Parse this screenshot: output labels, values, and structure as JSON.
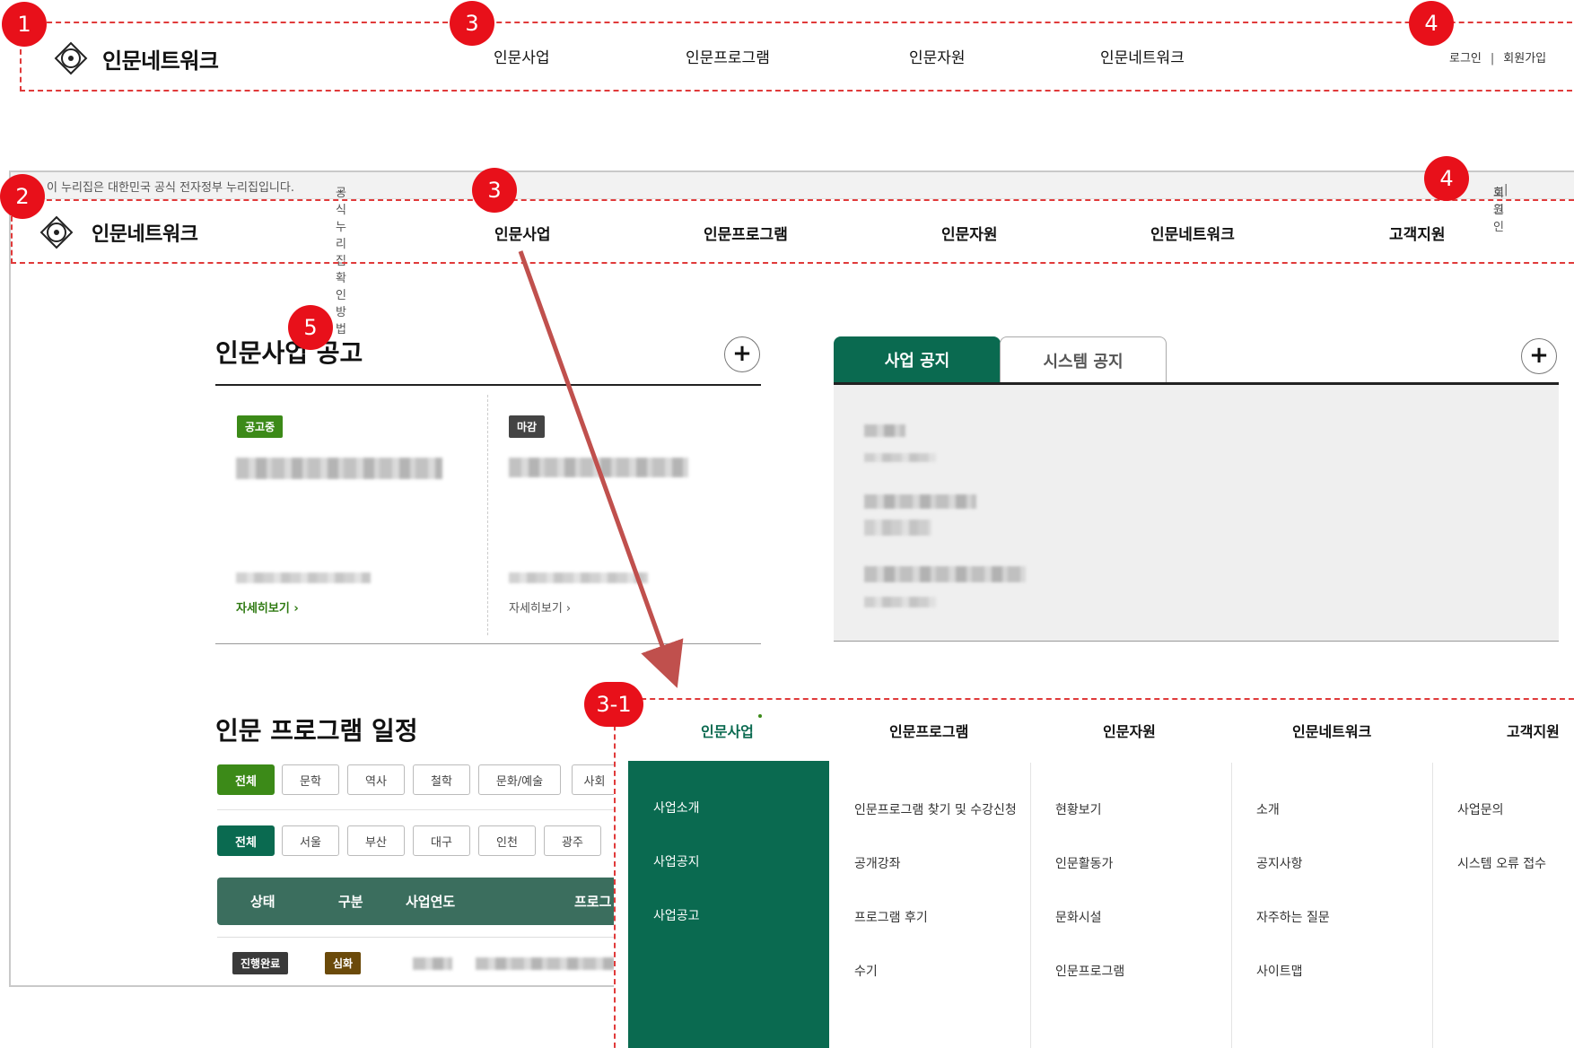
{
  "markers": [
    "1",
    "2",
    "3",
    "3",
    "4",
    "4",
    "5",
    "3-1"
  ],
  "header1": {
    "logo_text": "인문네트워크",
    "nav": [
      "인문사업",
      "인문프로그램",
      "인문자원",
      "인문네트워크"
    ],
    "login": "로그인",
    "signup": "회원가입",
    "separator": "|"
  },
  "browser": {
    "gov_notice": "이 누리집은 대한민국 공식 전자정부 누리집입니다.",
    "gov_check": "공식 누리집 확인방법",
    "login": "로그인",
    "signup": "회원",
    "separator": "|",
    "logo_text": "인문네트워크",
    "nav": [
      "인문사업",
      "인문프로그램",
      "인문자원",
      "인문네트워크",
      "고객지원"
    ]
  },
  "announcements": {
    "title": "인문사업 공고",
    "plus": "+",
    "cards": [
      {
        "badge": "공고중",
        "more": "자세히보기 ›",
        "badge_color": "#3c8a18",
        "more_color": "#2f7a12"
      },
      {
        "badge": "마감",
        "more": "자세히보기 ›",
        "badge_color": "#444444",
        "more_color": "#555555"
      }
    ]
  },
  "notices": {
    "tabs": [
      "사업 공지",
      "시스템 공지"
    ],
    "plus": "+"
  },
  "schedule": {
    "title": "인문 프로그램 일정",
    "filters1": [
      "전체",
      "문학",
      "역사",
      "철학",
      "문화/예술",
      "사회"
    ],
    "filters2": [
      "전체",
      "서울",
      "부산",
      "대구",
      "인천",
      "광주"
    ],
    "table_headers": [
      "상태",
      "구분",
      "사업연도",
      "프로그"
    ],
    "row": {
      "status": "진행완료",
      "type": "심화"
    }
  },
  "mega_menu": {
    "top": [
      "인문사업",
      "인문프로그램",
      "인문자원",
      "인문네트워크",
      "고객지원"
    ],
    "col1": [
      "사업소개",
      "사업공지",
      "사업공고"
    ],
    "col2": [
      "인문프로그램 찾기 및 수강신청",
      "공개강좌",
      "프로그램 후기",
      "수기"
    ],
    "col3": [
      "현황보기",
      "인문활동가",
      "문화시설",
      "인문프로그램"
    ],
    "col4": [
      "소개",
      "공지사항",
      "자주하는 질문",
      "사이트맵"
    ],
    "col5": [
      "사업문의",
      "시스템 오류 접수"
    ]
  },
  "colors": {
    "marker": "#e8101a",
    "brand_green": "#0a6a50",
    "accent_green": "#3c8a18",
    "table_header": "#3b6e5e"
  }
}
